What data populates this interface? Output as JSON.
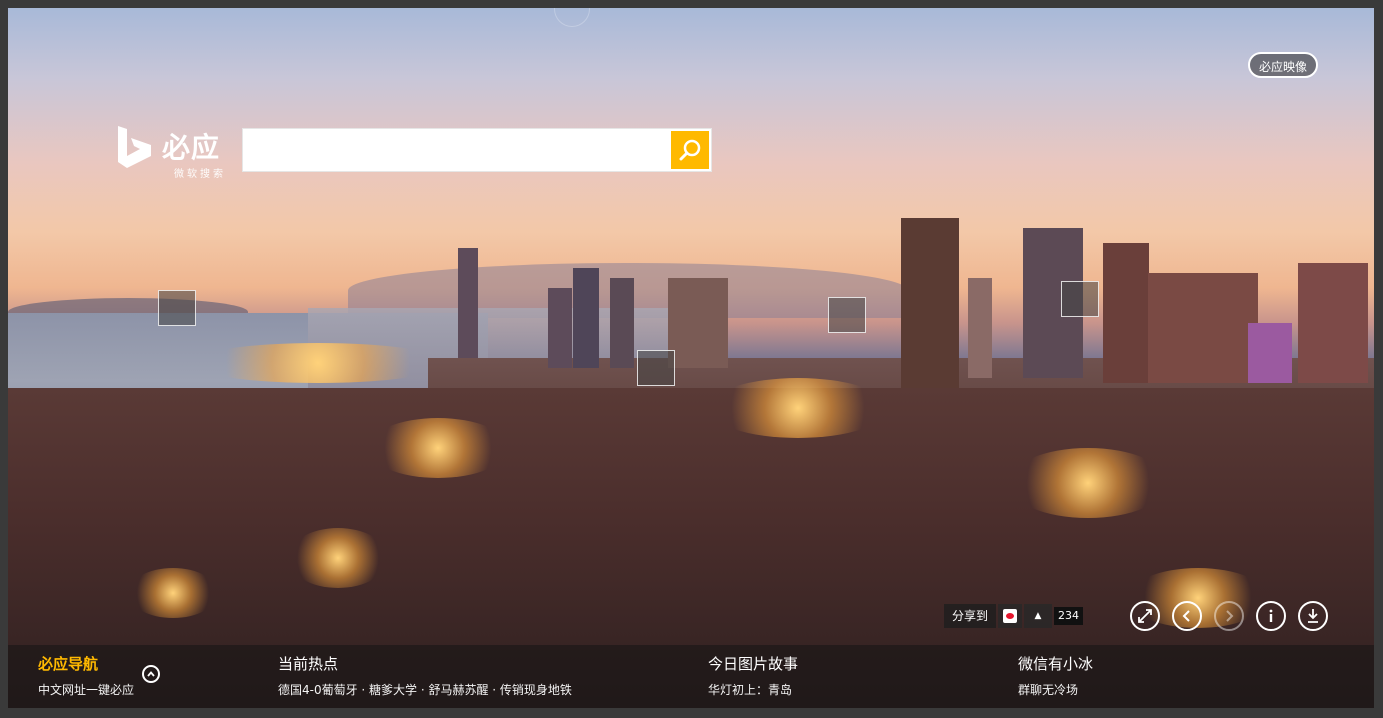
{
  "header": {
    "brand_button": "必应映像",
    "logo_name": "必应",
    "logo_sub": "微软搜索"
  },
  "search": {
    "value": "",
    "placeholder": ""
  },
  "share": {
    "label": "分享到",
    "count": "234"
  },
  "bottom": {
    "nav": {
      "title": "必应导航",
      "sub": "中文网址一键必应"
    },
    "hot": {
      "title": "当前热点",
      "sub": "德国4-0葡萄牙 · 糖爹大学 · 舒马赫苏醒 · 传销现身地铁"
    },
    "story": {
      "title": "今日图片故事",
      "sub": "华灯初上：青岛"
    },
    "wechat": {
      "title": "微信有小冰",
      "sub": "群聊无冷场"
    }
  },
  "colors": {
    "accent": "#ffb900"
  }
}
